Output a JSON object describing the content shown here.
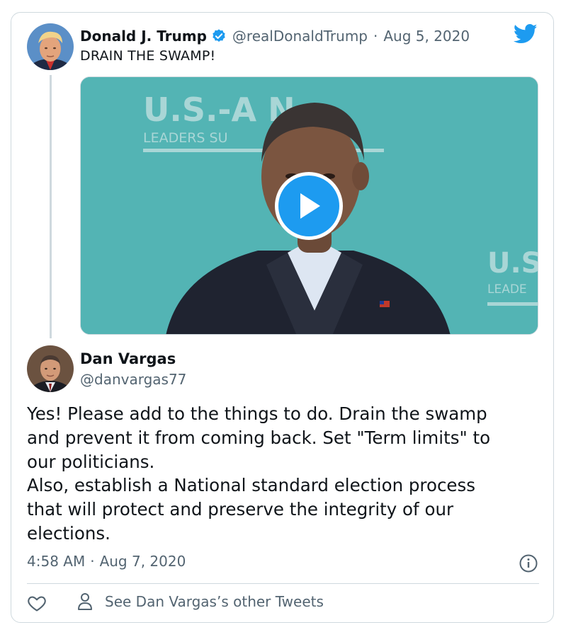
{
  "quoted_tweet": {
    "name": "Donald J. Trump",
    "handle": "@realDonaldTrump",
    "separator": "·",
    "date": "Aug 5, 2020",
    "text": "DRAIN THE SWAMP!",
    "video_backdrop": {
      "line1": "U.S.-A    N",
      "line2": "LEADERS SU",
      "right1": "U.S",
      "right2": "LEADE"
    }
  },
  "reply": {
    "name": "Dan Vargas",
    "handle": "@danvargas77",
    "body_lines": [
      "Yes! Please add to the things to do. Drain the swamp",
      "and prevent it from coming back. Set \"Term limits\" to",
      "our politicians.",
      "Also, establish a National standard election process",
      "that will protect and preserve the integrity of our",
      "elections."
    ],
    "time": "4:58 AM",
    "separator": "·",
    "date": "Aug 7, 2020"
  },
  "actions": {
    "see_other": "See Dan Vargas’s other Tweets"
  },
  "colors": {
    "accent": "#1d9bf0",
    "muted": "#536471",
    "border": "#cfd9de",
    "video_bg": "#4fb0b1"
  },
  "icons": [
    "verified-icon",
    "twitter-logo-icon",
    "play-icon",
    "info-icon",
    "heart-icon",
    "person-icon"
  ]
}
